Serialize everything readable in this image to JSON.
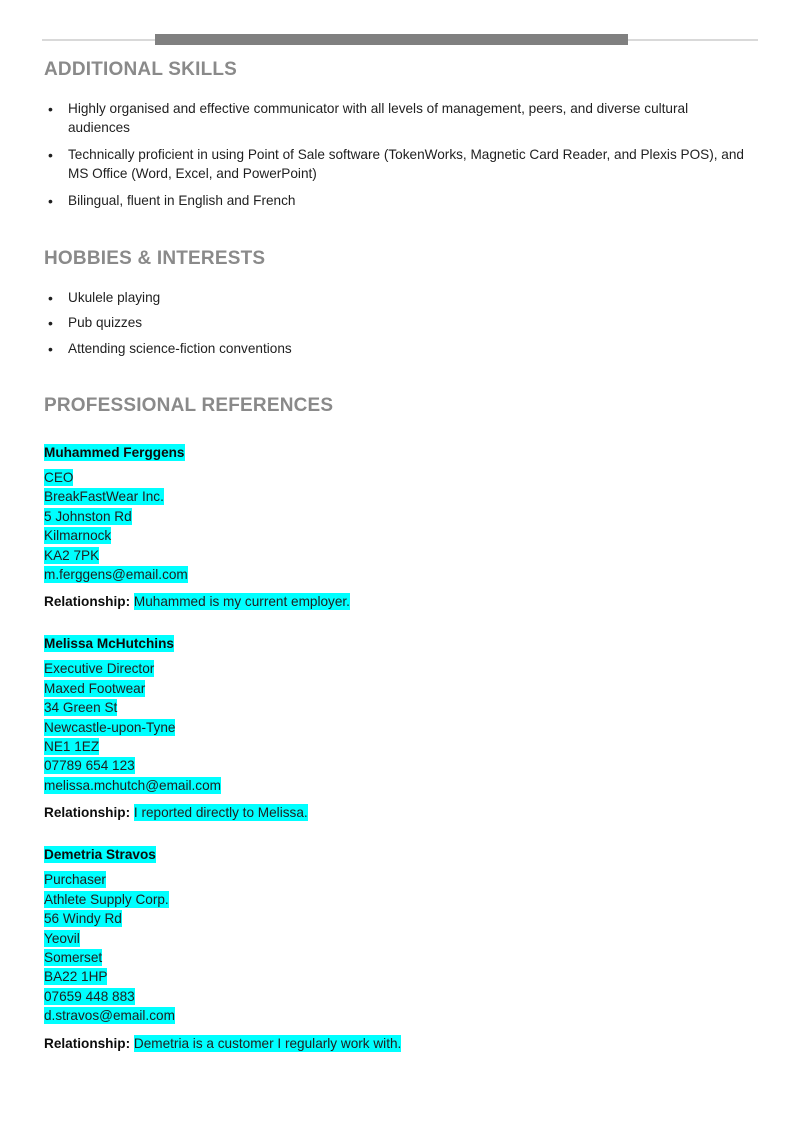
{
  "theme": {
    "highlight_color": "#00FFFF",
    "heading_color": "#8A8A8A",
    "rule_dark_color": "#808080",
    "rule_light_color": "#D9D9D9",
    "body_text_color": "#1F1F1F"
  },
  "sections": {
    "additional_skills": {
      "heading": "ADDITIONAL SKILLS",
      "bullets": [
        "Highly organised and effective communicator with all levels of management, peers, and diverse cultural audiences",
        "Technically proficient in using Point of Sale software (TokenWorks, Magnetic Card Reader, and Plexis POS), and MS Office (Word, Excel, and PowerPoint)",
        "Bilingual, fluent in English and French"
      ]
    },
    "hobbies_interests": {
      "heading": "HOBBIES & INTERESTS",
      "bullets": [
        "Ukulele playing",
        "Pub quizzes",
        "Attending science-fiction conventions"
      ]
    },
    "professional_references": {
      "heading": "PROFESSIONAL REFERENCES",
      "relationship_label": "Relationship:",
      "references": [
        {
          "name": "Muhammed Ferggens",
          "lines": [
            "CEO",
            "BreakFastWear Inc.",
            "5 Johnston Rd",
            "Kilmarnock",
            "KA2 7PK",
            "m.ferggens@email.com"
          ],
          "relationship": "Muhammed is my current employer."
        },
        {
          "name": "Melissa McHutchins",
          "lines": [
            "Executive Director",
            "Maxed Footwear",
            "34 Green St",
            "Newcastle-upon-Tyne",
            "NE1 1EZ",
            "07789 654 123",
            "melissa.mchutch@email.com"
          ],
          "relationship": "I reported directly to Melissa."
        },
        {
          "name": "Demetria Stravos",
          "lines": [
            "Purchaser",
            "Athlete Supply Corp.",
            "56 Windy Rd",
            "Yeovil",
            "Somerset",
            "BA22 1HP",
            "07659 448 883",
            "d.stravos@email.com"
          ],
          "relationship": "Demetria is a customer I regularly work with."
        }
      ]
    }
  }
}
